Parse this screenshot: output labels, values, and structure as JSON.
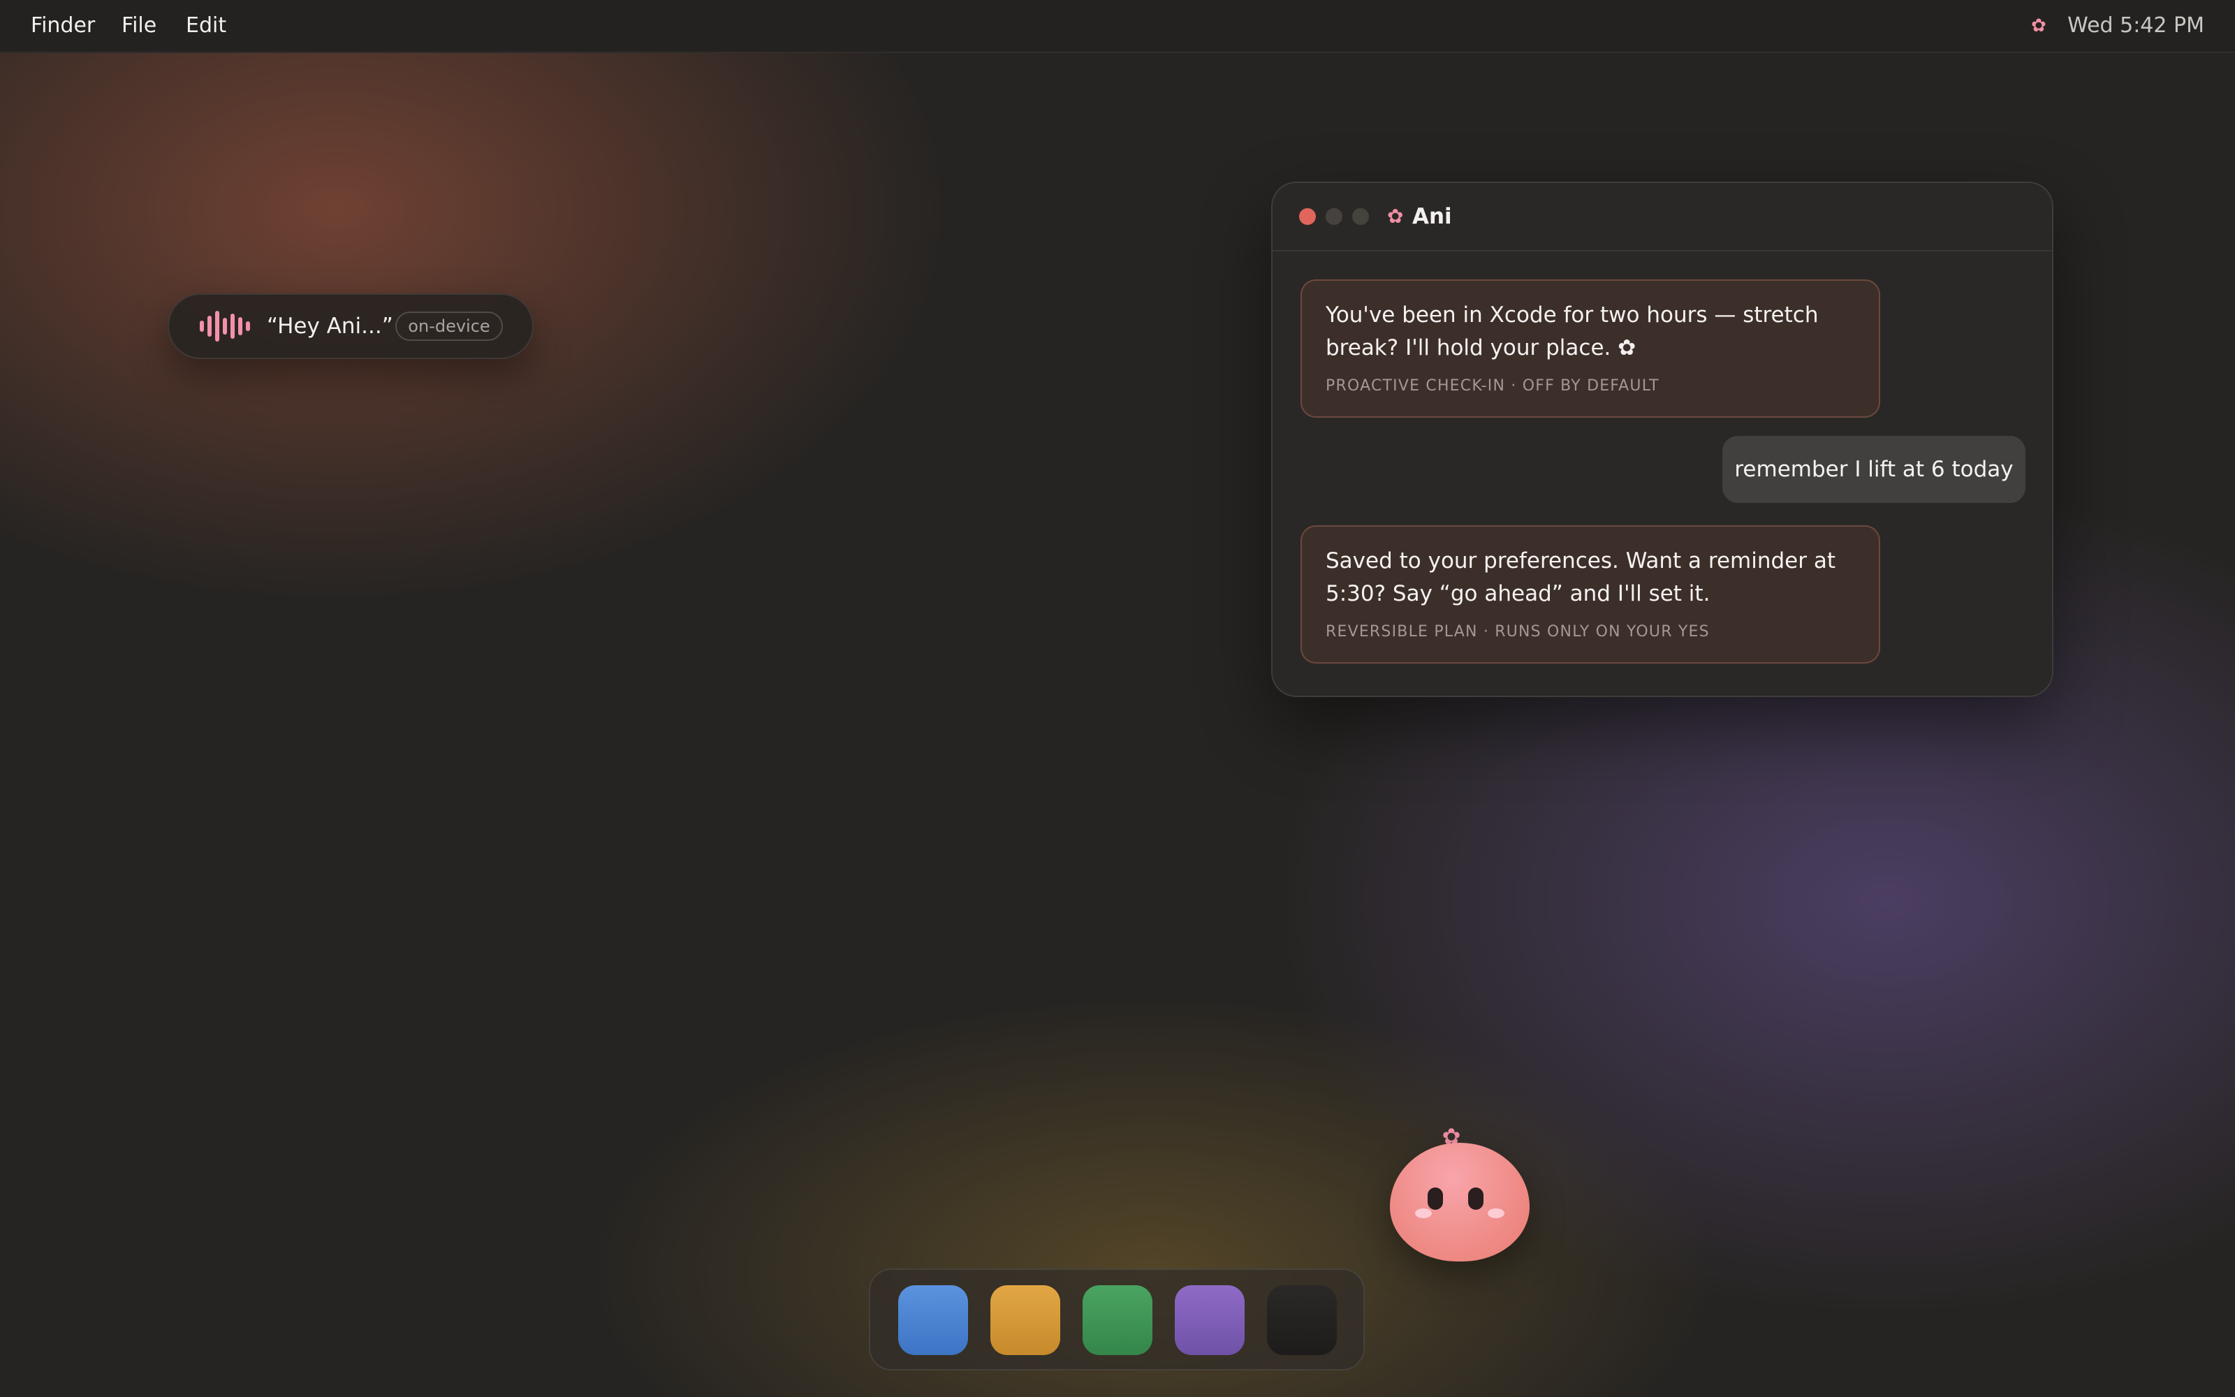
{
  "menubar": {
    "items": [
      "Finder",
      "File",
      "Edit"
    ],
    "status_icon": "flower-icon",
    "clock": "Wed 5:42 PM"
  },
  "voice": {
    "icon": "waveform-icon",
    "text": "“Hey Ani...”",
    "badge": "on-device"
  },
  "ani_window": {
    "title_icon": "✿",
    "title": "Ani",
    "messages": [
      {
        "from": "ani",
        "text": "You've been in Xcode for two hours — stretch break? I'll hold your place.",
        "emoji": "✿",
        "meta": "PROACTIVE CHECK-IN · OFF BY DEFAULT"
      },
      {
        "from": "user",
        "text": "remember I lift at 6 today"
      },
      {
        "from": "ani",
        "text": "Saved to your preferences. Want a reminder at 5:30? Say “go ahead” and I'll set it.",
        "meta": "REVERSIBLE PLAN · RUNS ONLY ON YOUR YES"
      }
    ]
  },
  "mascot": {
    "name": "ani-mascot",
    "accessory": "✿"
  },
  "dock": {
    "apps": [
      {
        "color": "#4a86d6"
      },
      {
        "color": "#d9a03e"
      },
      {
        "color": "#3f9a57"
      },
      {
        "color": "#8462bb"
      },
      {
        "color": "#242220"
      }
    ]
  },
  "colors": {
    "accent_pink": "#f08fa4",
    "ani_bubble": "#3c2f2a",
    "user_bubble": "#42403e",
    "window_bg": "#2a2826",
    "close_light": "#e0655c"
  }
}
